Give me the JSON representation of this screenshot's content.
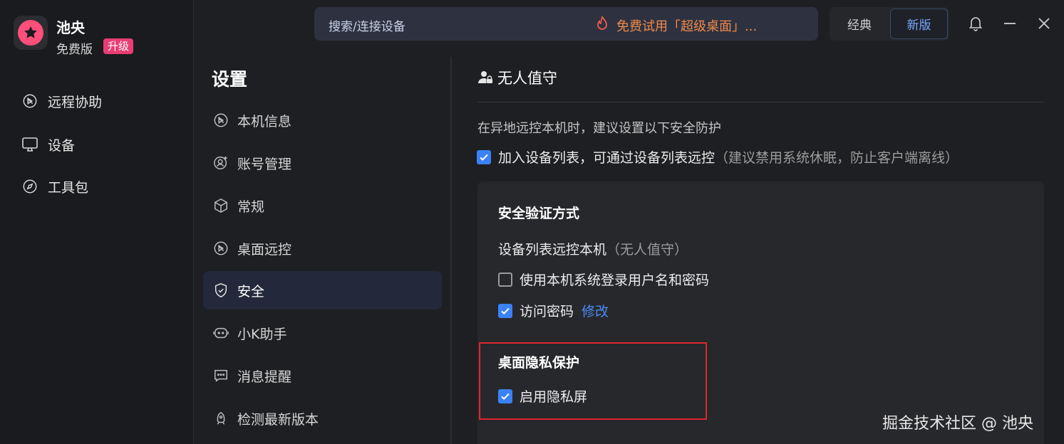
{
  "app": {
    "name": "池央",
    "edition": "免费版",
    "upgrade_label": "升级"
  },
  "nav": [
    {
      "label": "远程协助",
      "icon": "remote-assist-icon"
    },
    {
      "label": "设备",
      "icon": "monitor-icon"
    },
    {
      "label": "工具包",
      "icon": "compass-icon"
    }
  ],
  "topbar": {
    "search_placeholder": "搜索/连接设备",
    "promo_text": "免费试用「超级桌面」...",
    "mode_classic": "经典",
    "mode_new": "新版"
  },
  "settings": {
    "title": "设置",
    "menu": [
      {
        "label": "本机信息",
        "icon": "device-info-icon"
      },
      {
        "label": "账号管理",
        "icon": "account-icon"
      },
      {
        "label": "常规",
        "icon": "cube-icon"
      },
      {
        "label": "桌面远控",
        "icon": "desktop-remote-icon"
      },
      {
        "label": "安全",
        "icon": "shield-icon"
      },
      {
        "label": "小K助手",
        "icon": "assistant-icon"
      },
      {
        "label": "消息提醒",
        "icon": "message-icon"
      },
      {
        "label": "检测最新版本",
        "icon": "update-icon"
      }
    ]
  },
  "content": {
    "section_title": "无人值守",
    "description": "在异地远控本机时，建议设置以下安全防护",
    "add_to_list_label": "加入设备列表，可通过设备列表远控",
    "add_to_list_hint": "（建议禁用系统休眠，防止客户端离线）",
    "verify_title": "安全验证方式",
    "device_list_label": "设备列表远控本机",
    "device_list_hint": "（无人值守）",
    "system_login_label": "使用本机系统登录用户名和密码",
    "access_password_label": "访问密码",
    "modify_label": "修改",
    "privacy_title": "桌面隐私保护",
    "privacy_screen_label": "启用隐私屏"
  },
  "watermark": "掘金技术社区 @ 池央",
  "colors": {
    "accent": "#3b82f6",
    "promo": "#f08a4b",
    "badge": "#e93d74",
    "highlight": "#e0262b"
  }
}
